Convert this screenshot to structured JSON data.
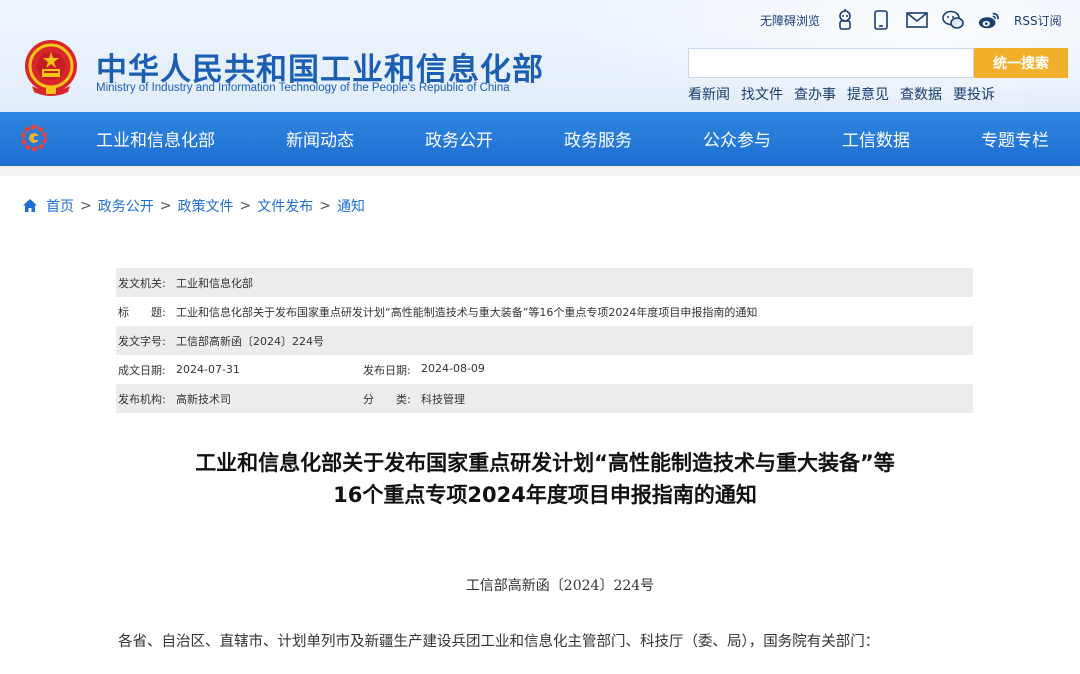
{
  "header": {
    "title": "中华人民共和国工业和信息化部",
    "subtitle": "Ministry of Industry and Information Technology of the People's Republic of China",
    "top_tools": {
      "accessibility": "无障碍浏览",
      "rss": "RSS订阅"
    },
    "search": {
      "placeholder": "",
      "button": "统一搜索"
    },
    "quick_links": [
      "看新闻",
      "找文件",
      "查办事",
      "提意见",
      "查数据",
      "要投诉"
    ],
    "brand_color": "#1e6fd2",
    "accent_color": "#f2b02a"
  },
  "nav": {
    "items": [
      "工业和信息化部",
      "新闻动态",
      "政务公开",
      "政务服务",
      "公众参与",
      "工信数据",
      "专题专栏"
    ]
  },
  "breadcrumb": [
    "首页",
    "政务公开",
    "政策文件",
    "文件发布",
    "通知"
  ],
  "meta": {
    "issuer_label": "发文机关:",
    "issuer": "工业和信息化部",
    "title_label": "标　　题:",
    "title": "工业和信息化部关于发布国家重点研发计划“高性能制造技术与重大装备”等16个重点专项2024年度项目申报指南的通知",
    "docno_label": "发文字号:",
    "docno": "工信部高新函〔2024〕224号",
    "created_label": "成文日期:",
    "created": "2024-07-31",
    "published_label": "发布日期:",
    "published": "2024-08-09",
    "agency_label": "发布机构:",
    "agency": "高新技术司",
    "category_label": "分　　类:",
    "category": "科技管理"
  },
  "article": {
    "title_line1": "工业和信息化部关于发布国家重点研发计划“高性能制造技术与重大装备”等",
    "title_line2": "16个重点专项2024年度项目申报指南的通知",
    "doc_no": "工信部高新函〔2024〕224号",
    "salutation": "各省、自治区、直辖市、计划单列市及新疆生产建设兵团工业和信息化主管部门、科技厅（委、局），国务院有关部门："
  },
  "icons": {
    "emblem": "national-emblem-icon",
    "nav_logo": "miit-logo-icon",
    "home": "home-icon"
  }
}
